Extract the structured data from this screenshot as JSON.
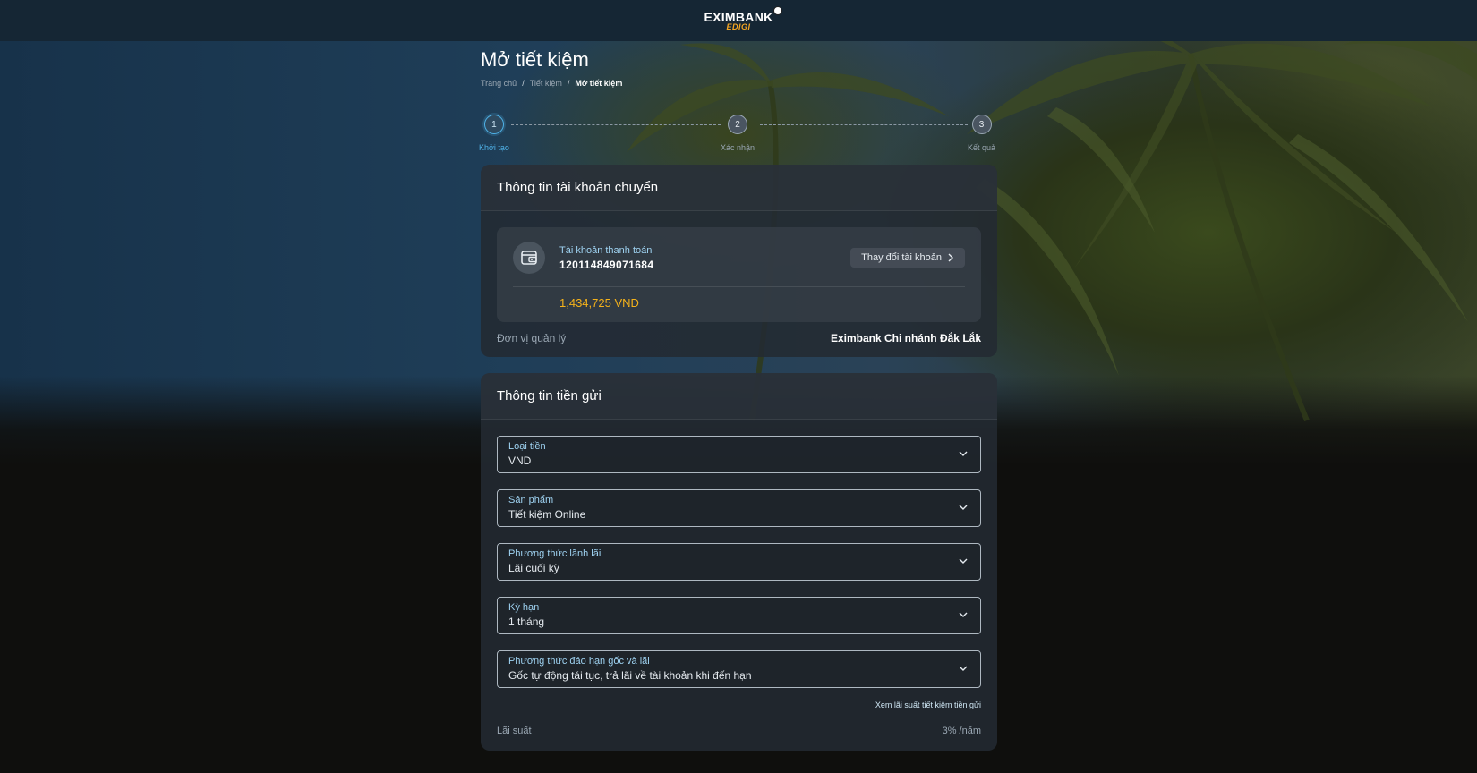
{
  "header": {
    "brand": "EXIMBANK",
    "sub_brand": "EDIGI"
  },
  "page": {
    "title": "Mở tiết kiệm",
    "breadcrumb": [
      "Trang chủ",
      "Tiết kiệm",
      "Mở tiết kiệm"
    ],
    "separator": "/"
  },
  "stepper": {
    "steps": [
      {
        "number": "1",
        "label": "Khởi tạo",
        "active": true
      },
      {
        "number": "2",
        "label": "Xác nhận",
        "active": false
      },
      {
        "number": "3",
        "label": "Kết quả",
        "active": false
      }
    ]
  },
  "source_account": {
    "title": "Thông tin tài khoản chuyển",
    "account_type": "Tài khoản thanh toán",
    "account_number": "120114849071684",
    "change_label": "Thay đổi tài khoản",
    "balance": "1,434,725 VND",
    "management_label": "Đơn vị quản lý",
    "management_value": "Eximbank Chi nhánh Đắk Lắk",
    "wallet_icon": "wallet-icon",
    "chevron_icon": "chevron-right-icon"
  },
  "deposit": {
    "title": "Thông tin tiền gửi",
    "fields": [
      {
        "label": "Loại tiền",
        "value": "VND"
      },
      {
        "label": "Sản phẩm",
        "value": "Tiết kiệm Online"
      },
      {
        "label": "Phương thức lãnh lãi",
        "value": "Lãi cuối kỳ"
      },
      {
        "label": "Kỳ hạn",
        "value": "1 tháng"
      },
      {
        "label": "Phương thức đáo hạn gốc và lãi",
        "value": "Gốc tự động tái tục, trả lãi về tài khoản khi đến hạn"
      }
    ],
    "rates_link": "Xem lãi suất tiết kiệm tiền gửi",
    "rate_label": "Lãi suất",
    "rate_value": "3% /năm"
  },
  "colors": {
    "accent_blue": "#4fb2e8",
    "balance_gold": "#f5b21a",
    "header_bg": "#152634"
  }
}
